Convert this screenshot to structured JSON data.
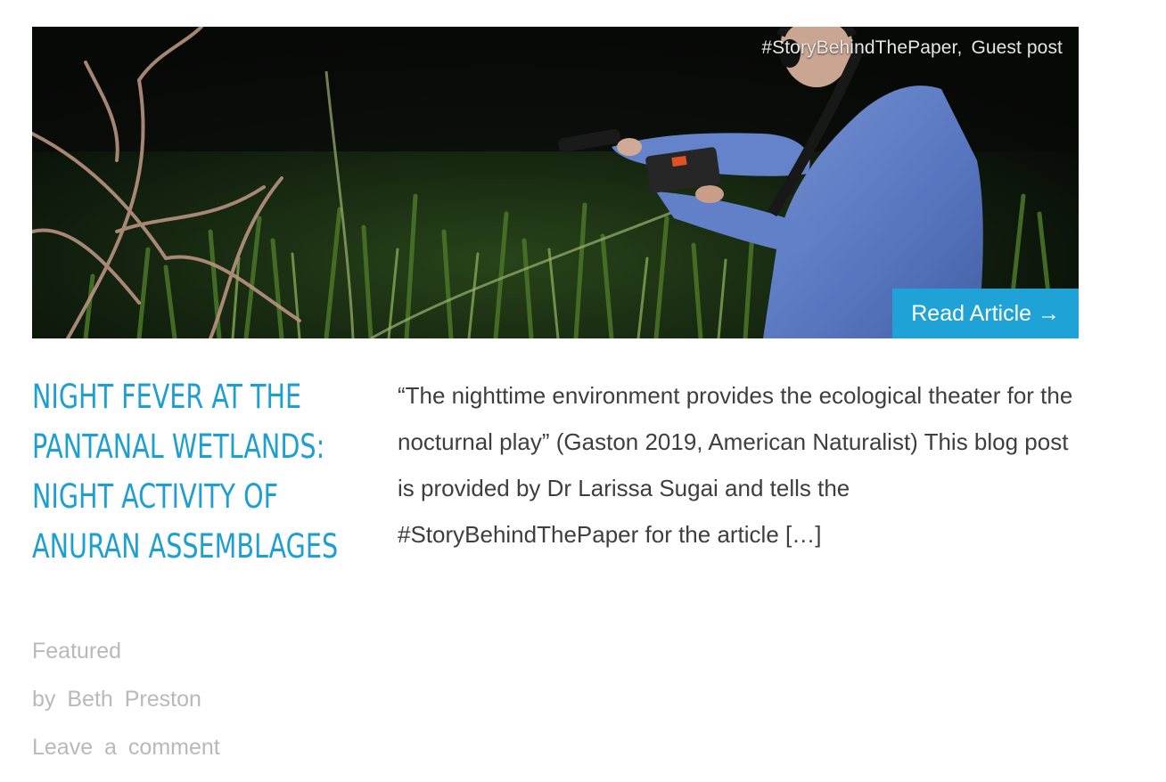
{
  "post": {
    "categories": [
      "#StoryBehindThePaper,",
      "Guest post"
    ],
    "read_more_label": "Read Article →",
    "title": "Night fever at the Pantanal wetlands: night activity of anuran assemblages",
    "meta": {
      "category": "Featured",
      "byline_prefix": "by",
      "author": "Beth Preston",
      "comments_label": "Leave a comment"
    },
    "excerpt": "“The nighttime environment provides the ecological theater for the nocturnal play” (Gaston 2019, American Naturalist) This blog post is provided by Dr Larissa Sugai and tells the #StoryBehindThePaper for the article […]"
  },
  "colors": {
    "accent": "#1fa3d6",
    "title": "#1e9fd2",
    "meta": "#b9b9b9",
    "body_text": "#3e3e3e"
  }
}
